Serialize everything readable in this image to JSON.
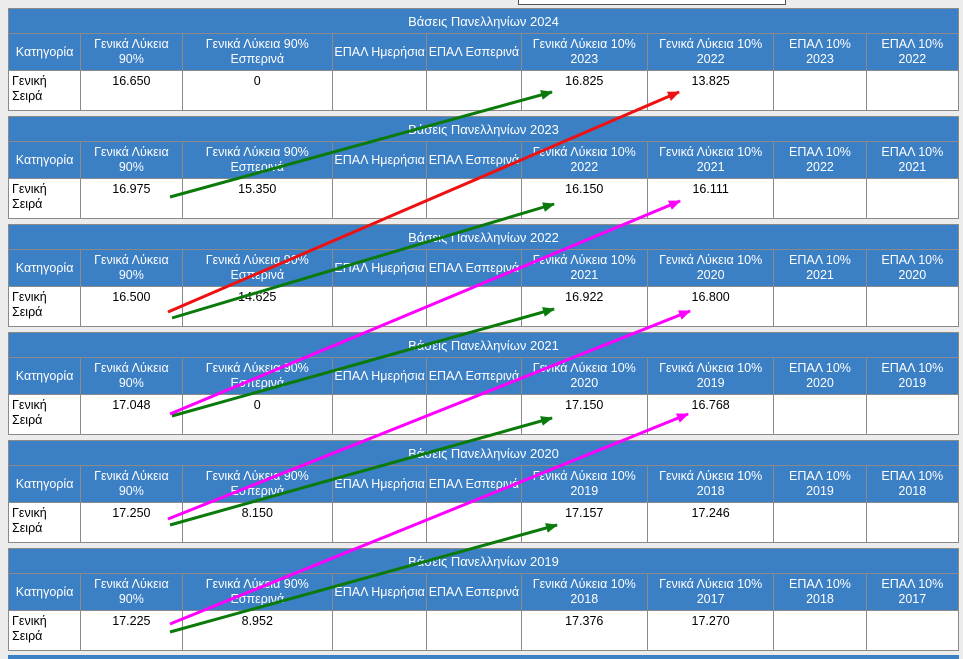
{
  "category_header": "Κατηγορία",
  "tables": [
    {
      "title": "Βάσεις Πανελληνίων 2024",
      "columns": [
        "Γενικά Λύκεια 90%",
        "Γενικά Λύκεια 90% Εσπερινά",
        "ΕΠΑΛ Ημερήσια",
        "ΕΠΑΛ Εσπερινά",
        "Γενικά Λύκεια 10% 2023",
        "Γενικά Λύκεια 10% 2022",
        "ΕΠΑΛ 10% 2023",
        "ΕΠΑΛ 10% 2022"
      ],
      "row": {
        "category": "Γενική Σειρά",
        "values": [
          "16.650",
          "0",
          "",
          "",
          "16.825",
          "13.825",
          "",
          ""
        ]
      }
    },
    {
      "title": "Βάσεις Πανελληνίων 2023",
      "columns": [
        "Γενικά Λύκεια 90%",
        "Γενικά Λύκεια 90% Εσπερινά",
        "ΕΠΑΛ Ημερήσια",
        "ΕΠΑΛ Εσπερινά",
        "Γενικά Λύκεια 10% 2022",
        "Γενικά Λύκεια 10% 2021",
        "ΕΠΑΛ 10% 2022",
        "ΕΠΑΛ 10% 2021"
      ],
      "row": {
        "category": "Γενική Σειρά",
        "values": [
          "16.975",
          "15.350",
          "",
          "",
          "16.150",
          "16.111",
          "",
          ""
        ]
      }
    },
    {
      "title": "Βάσεις Πανελληνίων 2022",
      "columns": [
        "Γενικά Λύκεια 90%",
        "Γενικά Λύκεια 90% Εσπερινά",
        "ΕΠΑΛ Ημερήσια",
        "ΕΠΑΛ Εσπερινά",
        "Γενικά Λύκεια 10% 2021",
        "Γενικά Λύκεια 10% 2020",
        "ΕΠΑΛ 10% 2021",
        "ΕΠΑΛ 10% 2020"
      ],
      "row": {
        "category": "Γενική Σειρά",
        "values": [
          "16.500",
          "14.625",
          "",
          "",
          "16.922",
          "16.800",
          "",
          ""
        ]
      }
    },
    {
      "title": "Βάσεις Πανελληνίων 2021",
      "columns": [
        "Γενικά Λύκεια 90%",
        "Γενικά Λύκεια 90% Εσπερινά",
        "ΕΠΑΛ Ημερήσια",
        "ΕΠΑΛ Εσπερινά",
        "Γενικά Λύκεια 10% 2020",
        "Γενικά Λύκεια 10% 2019",
        "ΕΠΑΛ 10% 2020",
        "ΕΠΑΛ 10% 2019"
      ],
      "row": {
        "category": "Γενική Σειρά",
        "values": [
          "17.048",
          "0",
          "",
          "",
          "17.150",
          "16.768",
          "",
          ""
        ]
      }
    },
    {
      "title": "Βάσεις Πανελληνίων 2020",
      "columns": [
        "Γενικά Λύκεια 90%",
        "Γενικά Λύκεια 90% Εσπερινά",
        "ΕΠΑΛ Ημερήσια",
        "ΕΠΑΛ Εσπερινά",
        "Γενικά Λύκεια 10% 2019",
        "Γενικά Λύκεια 10% 2018",
        "ΕΠΑΛ 10% 2019",
        "ΕΠΑΛ 10% 2018"
      ],
      "row": {
        "category": "Γενική Σειρά",
        "values": [
          "17.250",
          "8.150",
          "",
          "",
          "17.157",
          "17.246",
          "",
          ""
        ]
      }
    },
    {
      "title": "Βάσεις Πανελληνίων 2019",
      "columns": [
        "Γενικά Λύκεια 90%",
        "Γενικά Λύκεια 90% Εσπερινά",
        "ΕΠΑΛ Ημερήσια",
        "ΕΠΑΛ Εσπερινά",
        "Γενικά Λύκεια 10% 2018",
        "Γενικά Λύκεια 10% 2017",
        "ΕΠΑΛ 10% 2018",
        "ΕΠΑΛ 10% 2017"
      ],
      "row": {
        "category": "Γενική Σειρά",
        "values": [
          "17.225",
          "8.952",
          "",
          "",
          "17.376",
          "17.270",
          "",
          ""
        ]
      }
    }
  ],
  "annotation_colors": {
    "green": "#0a7a0a",
    "red": "#ee1111",
    "magenta": "#ff00ff"
  },
  "colors": {
    "header_bg": "#3b7fc4",
    "grid": "#8a8a8a",
    "page_bg": "#ececec"
  }
}
